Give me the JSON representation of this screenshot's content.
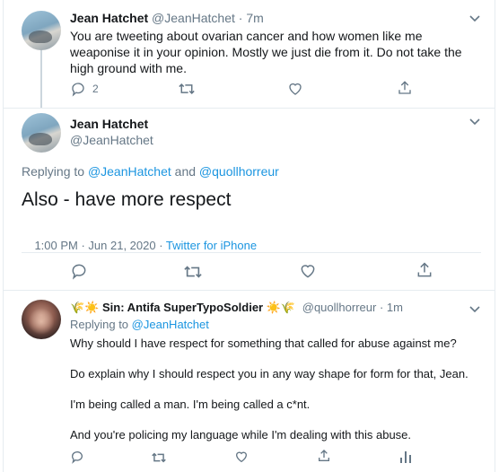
{
  "tweet1": {
    "author_name": "Jean Hatchet",
    "author_handle": "@JeanHatchet",
    "separator": "·",
    "time": "7m",
    "text": "You are tweeting about ovarian cancer and how women like me weaponise it in your opinion. Mostly we just die from it. Do not take the high ground with me.",
    "reply_count": "2"
  },
  "tweet2": {
    "author_name": "Jean Hatchet",
    "author_handle": "@JeanHatchet",
    "replying_prefix": "Replying to",
    "replying_user1": "@JeanHatchet",
    "replying_and": "and",
    "replying_user2": "@quollhorreur",
    "text": "Also - have more respect",
    "timestamp": "1:00 PM · Jun 21, 2020 · ",
    "source": "Twitter for iPhone"
  },
  "tweet3": {
    "emoji_left": "🌾☀️",
    "author_name": "Sin: Antifa SuperTypoSoldier",
    "emoji_right": "☀️🌾",
    "author_handle": "@quollhorreur",
    "separator": "·",
    "time": "1m",
    "replying_prefix": "Replying to",
    "replying_user": "@JeanHatchet",
    "paragraphs": [
      "Why should I have respect for something that called for abuse against me?",
      "Do explain why I should respect you in any way shape for form for that, Jean.",
      "I'm being called a man. I'm being called a c*nt.",
      "And you're policing my language while I'm dealing with this abuse."
    ]
  },
  "icons": [
    "reply-icon",
    "retweet-icon",
    "like-icon",
    "share-icon",
    "analytics-icon",
    "chevron-down-icon"
  ],
  "colors": {
    "link": "#1b95e0",
    "muted": "#657786",
    "text": "#14171a",
    "divider": "#e6ecf0"
  }
}
